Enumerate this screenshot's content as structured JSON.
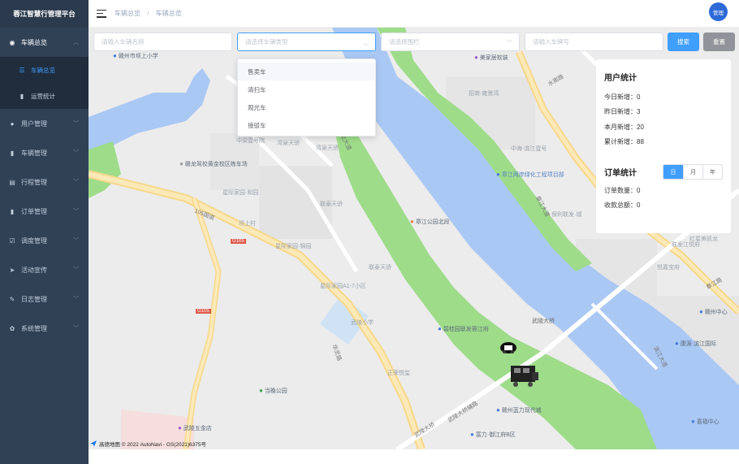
{
  "app": {
    "title": "蓉江智慧行管理平台"
  },
  "sidebar": {
    "items": [
      {
        "label": "车辆总览",
        "icon": "globe-icon",
        "open": true,
        "children": [
          {
            "label": "车辆总览",
            "icon": "list-icon",
            "active": true
          },
          {
            "label": "运营统计",
            "icon": "bar-chart-icon",
            "active": false
          }
        ]
      },
      {
        "label": "用户管理",
        "icon": "user-icon"
      },
      {
        "label": "车辆管理",
        "icon": "book-icon"
      },
      {
        "label": "行程管理",
        "icon": "document-icon"
      },
      {
        "label": "订单管理",
        "icon": "book-icon"
      },
      {
        "label": "调度管理",
        "icon": "checkbox-icon"
      },
      {
        "label": "活动宣传",
        "icon": "send-icon"
      },
      {
        "label": "日志管理",
        "icon": "edit-icon"
      },
      {
        "label": "系统管理",
        "icon": "gear-icon"
      }
    ]
  },
  "header": {
    "breadcrumb": [
      "车辆总览",
      "车辆总览"
    ],
    "avatar_text": "管理"
  },
  "filters": {
    "name_placeholder": "请输入车辆名称",
    "type_placeholder": "请选择车辆类型",
    "fence_placeholder": "请选择围栏",
    "plate_placeholder": "请输入车牌号",
    "search_label": "搜索",
    "reset_label": "重置"
  },
  "dropdown": {
    "options": [
      "售卖车",
      "清扫车",
      "观光车",
      "接驳车"
    ]
  },
  "stats": {
    "user_title": "用户统计",
    "user_rows": [
      "今日新增：0",
      "昨日新增：3",
      "本月新增：20",
      "累计新增：88"
    ],
    "order_title": "订单统计",
    "order_tabs": [
      "日",
      "月",
      "年"
    ],
    "order_active_tab": "日",
    "order_rows": [
      "订单数量：0",
      "收款总额：0"
    ]
  },
  "map": {
    "pois": [
      "赣州市坝上小学",
      "美家居软装",
      "招商·雍景湾",
      "中海·滨江壹号",
      "章江两岸绿化工程项目部",
      "保利联发·城",
      "赣龙驾校黄金校区练车场",
      "中梁壹号院",
      "湾泉天骄",
      "星际家园·和园",
      "联泰天骄",
      "章江公园北段",
      "坝上村",
      "星际家园·锦园",
      "联泰天骄",
      "星际家园A1-7小区",
      "武陵小学",
      "碧桂园联发蓉江府",
      "正荣悦玺",
      "当晚公园",
      "赣州蓝力现代城",
      "武陵五金店",
      "富力·御江府B区",
      "红星美凯龙",
      "赣州中心",
      "康源·滨江国际",
      "喜福中心",
      "联发江悦府",
      "悦嘉宝府",
      "湾泉天骄",
      "武陵大桥"
    ],
    "roads": [
      "105国道",
      "G105",
      "G105",
      "滨江大道",
      "章江北大道",
      "武陵大桥辅路",
      "武陵大桥",
      "章江大道",
      "水南路",
      "华灵路",
      "章江路"
    ],
    "credit": "高德地图 © 2022 AutoNavi - GS(2021)6375号"
  },
  "colors": {
    "sidebar_bg": "#304156",
    "accent": "#409eff",
    "river": "#aac8f4",
    "park": "#9edc8a"
  }
}
